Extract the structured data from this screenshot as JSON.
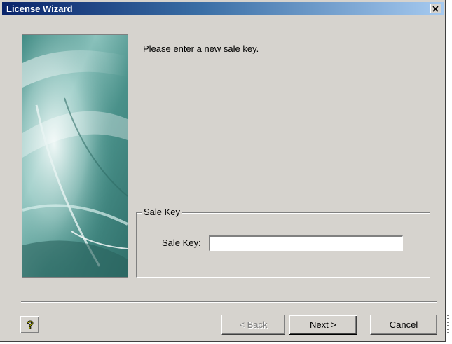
{
  "window": {
    "title": "License Wizard",
    "close_icon": "close-icon"
  },
  "content": {
    "prompt": "Please enter a new sale key."
  },
  "sale_key_group": {
    "legend": "Sale Key",
    "field_label": "Sale Key:",
    "field_value": ""
  },
  "footer": {
    "help_icon": "help-question-icon",
    "back_label": "< Back",
    "next_label": "Next >",
    "cancel_label": "Cancel",
    "back_enabled": false
  },
  "colors": {
    "titlebar_start": "#0a246a",
    "titlebar_end": "#a6caf0",
    "window_bg": "#d6d3ce",
    "help_icon_yellow": "#ffff00"
  }
}
